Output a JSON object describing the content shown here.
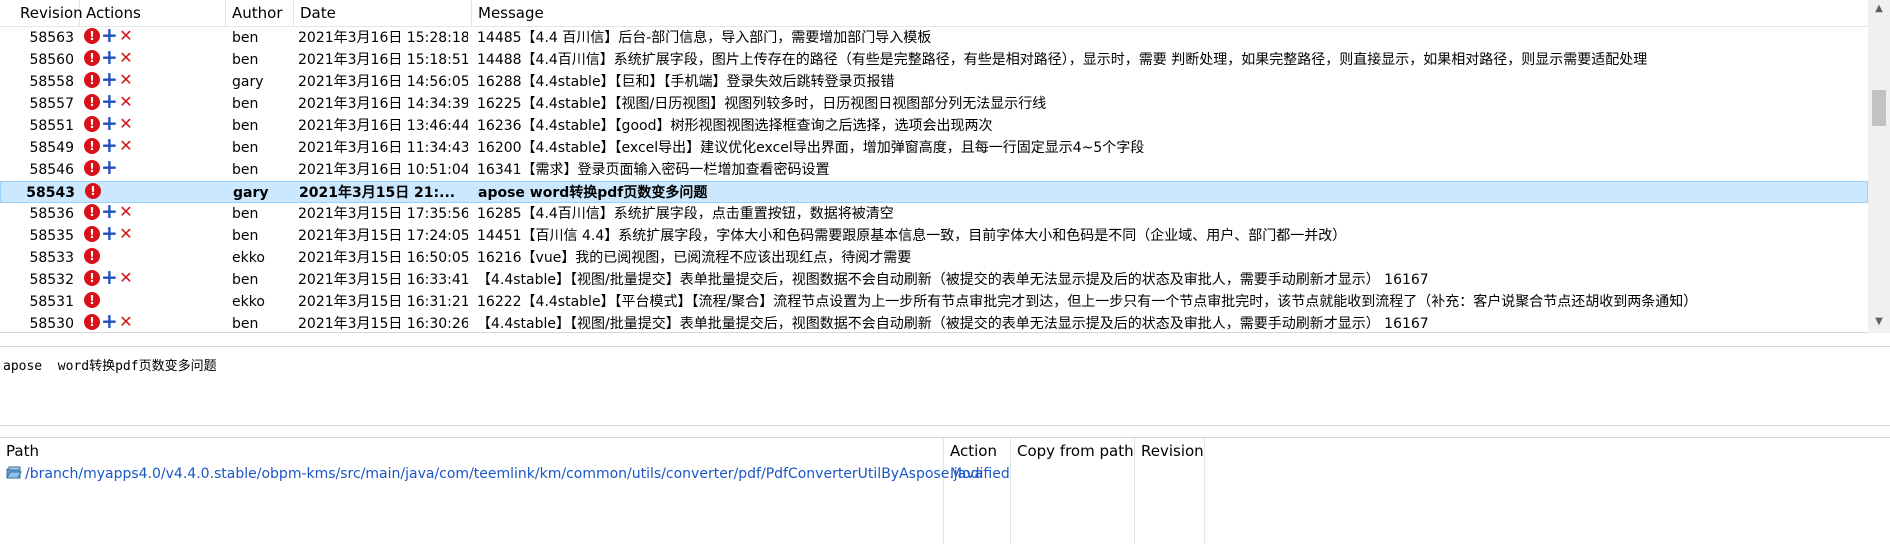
{
  "log": {
    "columns": {
      "revision": "Revision",
      "actions": "Actions",
      "author": "Author",
      "date": "Date",
      "message": "Message"
    },
    "rows": [
      {
        "revision": "58563",
        "actions": [
          "warning",
          "added",
          "deleted"
        ],
        "author": "ben",
        "date": "2021年3月16日 15:28:18",
        "message": "14485【4.4 百川信】后台-部门信息，导入部门，需要增加部门导入模板"
      },
      {
        "revision": "58560",
        "actions": [
          "warning",
          "added",
          "deleted"
        ],
        "author": "ben",
        "date": "2021年3月16日 15:18:51",
        "message": "14488【4.4百川信】系统扩展字段，图片上传存在的路径（有些是完整路径，有些是相对路径），显示时，需要 判断处理，如果完整路径，则直接显示，如果相对路径，则显示需要适配处理"
      },
      {
        "revision": "58558",
        "actions": [
          "warning",
          "added",
          "deleted"
        ],
        "author": "gary",
        "date": "2021年3月16日 14:56:05",
        "message": "16288【4.4stable】【巨和】【手机端】登录失效后跳转登录页报错"
      },
      {
        "revision": "58557",
        "actions": [
          "warning",
          "added",
          "deleted"
        ],
        "author": "ben",
        "date": "2021年3月16日 14:34:39",
        "message": "16225【4.4stable】【视图/日历视图】视图列较多时，日历视图日视图部分列无法显示行线"
      },
      {
        "revision": "58551",
        "actions": [
          "warning",
          "added",
          "deleted"
        ],
        "author": "ben",
        "date": "2021年3月16日 13:46:44",
        "message": "16236【4.4stable】【good】树形视图视图选择框查询之后选择，选项会出现两次"
      },
      {
        "revision": "58549",
        "actions": [
          "warning",
          "added",
          "deleted"
        ],
        "author": "ben",
        "date": "2021年3月16日 11:34:43",
        "message": "16200【4.4stable】【excel导出】建议优化excel导出界面，增加弹窗高度，且每一行固定显示4~5个字段"
      },
      {
        "revision": "58546",
        "actions": [
          "warning",
          "added"
        ],
        "author": "ben",
        "date": "2021年3月16日 10:51:04",
        "message": "16341【需求】登录页面输入密码一栏增加查看密码设置"
      },
      {
        "revision": "58543",
        "actions": [
          "warning"
        ],
        "author": "gary",
        "date": "2021年3月15日 21:...",
        "message": "apose  word转换pdf页数变多问题",
        "selected": true
      },
      {
        "revision": "58536",
        "actions": [
          "warning",
          "added",
          "deleted"
        ],
        "author": "ben",
        "date": "2021年3月15日 17:35:56",
        "message": "16285【4.4百川信】系统扩展字段，点击重置按钮，数据将被清空"
      },
      {
        "revision": "58535",
        "actions": [
          "warning",
          "added",
          "deleted"
        ],
        "author": "ben",
        "date": "2021年3月15日 17:24:05",
        "message": "14451【百川信 4.4】系统扩展字段，字体大小和色码需要跟原基本信息一致，目前字体大小和色码是不同（企业域、用户、部门都一并改）"
      },
      {
        "revision": "58533",
        "actions": [
          "warning"
        ],
        "author": "ekko",
        "date": "2021年3月15日 16:50:05",
        "message": "16216【vue】我的已阅视图，已阅流程不应该出现红点，待阅才需要"
      },
      {
        "revision": "58532",
        "actions": [
          "warning",
          "added",
          "deleted"
        ],
        "author": "ben",
        "date": "2021年3月15日 16:33:41",
        "message": "【4.4stable】【视图/批量提交】表单批量提交后，视图数据不会自动刷新（被提交的表单无法显示提及后的状态及审批人，需要手动刷新才显示） 16167"
      },
      {
        "revision": "58531",
        "actions": [
          "warning"
        ],
        "author": "ekko",
        "date": "2021年3月15日 16:31:21",
        "message": "16222【4.4stable】【平台模式】【流程/聚合】流程节点设置为上一步所有节点审批完才到达，但上一步只有一个节点审批完时，该节点就能收到流程了（补充：客户说聚合节点还胡收到两条通知）"
      },
      {
        "revision": "58530",
        "actions": [
          "warning",
          "added",
          "deleted"
        ],
        "author": "ben",
        "date": "2021年3月15日 16:30:26",
        "message": "【4.4stable】【视图/批量提交】表单批量提交后，视图数据不会自动刷新（被提交的表单无法显示提及后的状态及审批人，需要手动刷新才显示） 16167"
      }
    ]
  },
  "message_pane": {
    "text": "apose  word转换pdf页数变多问题"
  },
  "paths": {
    "columns": {
      "path": "Path",
      "action": "Action",
      "copy_from_path": "Copy from path",
      "revision": "Revision"
    },
    "rows": [
      {
        "path": "/branch/myapps4.0/v4.4.0.stable/obpm-kms/src/main/java/com/teemlink/km/common/utils/converter/pdf/PdfConverterUtilByAspose.java",
        "action": "Modified",
        "copy_from_path": "",
        "revision": ""
      }
    ]
  },
  "colors": {
    "selection_bg": "#cce8ff",
    "selection_border": "#99d1ff",
    "path_link": "#1a56c8",
    "warning_red": "#d9101a",
    "add_blue": "#1e4fc2",
    "delete_red": "#d11414"
  }
}
